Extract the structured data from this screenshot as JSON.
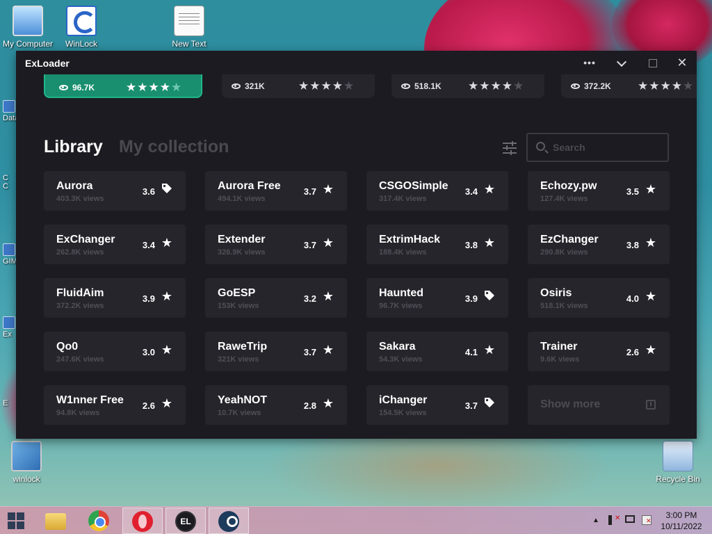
{
  "desktop": {
    "icons": [
      {
        "label": "My Computer"
      },
      {
        "label": "WinLock"
      },
      {
        "label": "New Text"
      },
      {
        "label": "winlock"
      },
      {
        "label": "Recycle Bin"
      }
    ],
    "partial_labels": [
      "Data",
      "C",
      "C",
      "GIM",
      "Ex",
      "E"
    ]
  },
  "app": {
    "title": "ExLoader",
    "window_controls": {
      "more": "•••",
      "close": "✕"
    },
    "featured": [
      {
        "views": "96.7K",
        "rating_stars": 4,
        "active": true
      },
      {
        "views": "321K",
        "rating_stars": 4,
        "active": false
      },
      {
        "views": "518.1K",
        "rating_stars": 4,
        "active": false
      },
      {
        "views": "372.2K",
        "rating_stars": 4,
        "active": false
      }
    ],
    "tabs": {
      "library": "Library",
      "collection": "My collection"
    },
    "search": {
      "placeholder": "Search"
    },
    "items": [
      {
        "name": "Aurora",
        "views": "403.3K views",
        "rating": "3.6",
        "icon": "tag-icon"
      },
      {
        "name": "Aurora Free",
        "views": "494.1K views",
        "rating": "3.7",
        "icon": "star-icon"
      },
      {
        "name": "CSGOSimple",
        "views": "317.4K views",
        "rating": "3.4",
        "icon": "star-icon"
      },
      {
        "name": "Echozy.pw",
        "views": "127.4K views",
        "rating": "3.5",
        "icon": "star-icon"
      },
      {
        "name": "ExChanger",
        "views": "262.8K views",
        "rating": "3.4",
        "icon": "star-icon"
      },
      {
        "name": "Extender",
        "views": "326.9K views",
        "rating": "3.7",
        "icon": "star-icon"
      },
      {
        "name": "ExtrimHack",
        "views": "188.4K views",
        "rating": "3.8",
        "icon": "star-icon"
      },
      {
        "name": "EzChanger",
        "views": "290.8K views",
        "rating": "3.8",
        "icon": "star-icon"
      },
      {
        "name": "FluidAim",
        "views": "372.2K views",
        "rating": "3.9",
        "icon": "star-icon"
      },
      {
        "name": "GoESP",
        "views": "153K views",
        "rating": "3.2",
        "icon": "star-icon"
      },
      {
        "name": "Haunted",
        "views": "96.7K views",
        "rating": "3.9",
        "icon": "tag-icon"
      },
      {
        "name": "Osiris",
        "views": "518.1K views",
        "rating": "4.0",
        "icon": "star-icon"
      },
      {
        "name": "Qo0",
        "views": "247.6K views",
        "rating": "3.0",
        "icon": "star-icon"
      },
      {
        "name": "RaweTrip",
        "views": "321K views",
        "rating": "3.7",
        "icon": "star-icon"
      },
      {
        "name": "Sakara",
        "views": "54.3K views",
        "rating": "4.1",
        "icon": "star-icon"
      },
      {
        "name": "Trainer",
        "views": "9.6K views",
        "rating": "2.6",
        "icon": "star-icon"
      },
      {
        "name": "W1nner Free",
        "views": "94.8K views",
        "rating": "2.6",
        "icon": "star-icon"
      },
      {
        "name": "YeahNOT",
        "views": "10.7K views",
        "rating": "2.8",
        "icon": "star-icon"
      },
      {
        "name": "iChanger",
        "views": "154.5K views",
        "rating": "3.7",
        "icon": "tag-icon"
      }
    ],
    "show_more": "Show more",
    "colors": {
      "background": "#1c1b21",
      "card": "#26252c",
      "accent": "#1fb68b"
    }
  },
  "taskbar": {
    "apps": [
      "file-explorer",
      "chrome",
      "opera",
      "exloader",
      "steam"
    ],
    "exloader_glyph": "EL",
    "clock": {
      "time": "3:00 PM",
      "date": "10/11/2022"
    }
  }
}
